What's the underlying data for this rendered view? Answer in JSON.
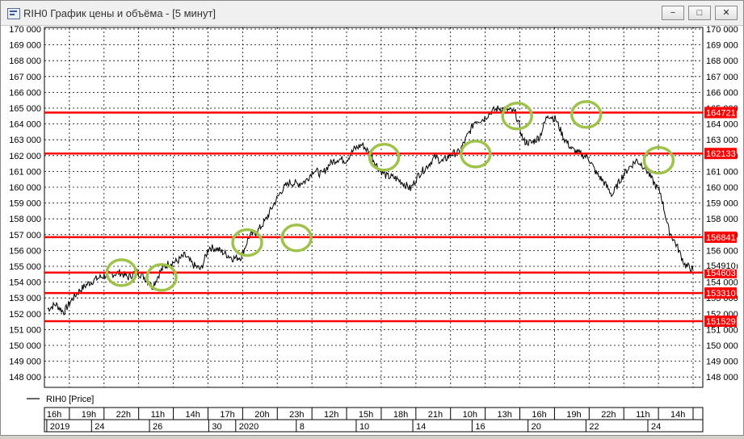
{
  "window": {
    "title": "RIH0 График цены и объёма - [5 минут]",
    "icon": "chart-window-icon",
    "buttons": [
      "minimize-icon",
      "restore-icon",
      "close-icon"
    ]
  },
  "chart_data": {
    "type": "line",
    "ylim": [
      148000,
      170000
    ],
    "y_ticks": [
      "170 000",
      "169 000",
      "168 000",
      "167 000",
      "166 000",
      "165 000",
      "164 000",
      "163 000",
      "162 000",
      "161 000",
      "160 000",
      "159 000",
      "158 000",
      "157 000",
      "156 000",
      "155 000",
      "154 000",
      "153 000",
      "152 000",
      "151 000",
      "150 000",
      "149 000",
      "148 000"
    ],
    "grid": true,
    "legend": {
      "label": "RIH0 [Price]",
      "placement": "bottom-left"
    },
    "x_ticks_top": [
      "16h",
      "19h",
      "22h",
      "11h",
      "14h",
      "17h",
      "20h",
      "23h",
      "12h",
      "15h",
      "18h",
      "21h",
      "10h",
      "13h",
      "16h",
      "19h",
      "22h",
      "11h",
      "14h"
    ],
    "x_ticks_bottom": [
      "2019",
      "24",
      "26",
      "30",
      "2020",
      "8",
      "10",
      "14",
      "16",
      "20",
      "22",
      "24"
    ],
    "series": [
      {
        "name": "RIH0 [Price]",
        "color": "#000000",
        "values": [
          152300,
          152600,
          152100,
          152900,
          153500,
          153900,
          154200,
          154400,
          154500,
          154600,
          154300,
          154700,
          154300,
          153700,
          154700,
          155200,
          155300,
          155700,
          155100,
          154800,
          156200,
          156100,
          155800,
          155500,
          155600,
          156900,
          157200,
          157900,
          158900,
          159800,
          160300,
          160200,
          160400,
          161100,
          160800,
          161500,
          161800,
          161700,
          162400,
          162700,
          162100,
          161200,
          160700,
          160600,
          160300,
          159900,
          160800,
          161300,
          161900,
          161600,
          162100,
          162200,
          163200,
          164200,
          164300,
          164800,
          165000,
          164900,
          164700,
          162900,
          162800,
          163200,
          164600,
          164300,
          163100,
          162400,
          162100,
          161900,
          160900,
          160300,
          159500,
          160500,
          161200,
          161700,
          161300,
          160400,
          159600,
          157300,
          156300,
          155100,
          154800
        ]
      }
    ],
    "levels": [
      {
        "value": 164721,
        "label": "164721"
      },
      {
        "value": 162133,
        "label": "162133"
      },
      {
        "value": 156841,
        "label": "156841"
      },
      {
        "value": 154603,
        "label": "154603"
      },
      {
        "value": 153310,
        "label": "153310"
      },
      {
        "value": 151529,
        "label": "151529"
      }
    ],
    "last_price_label": "154910",
    "level_color": "#ff0000",
    "highlight_color": "#9fc34a",
    "highlights": [
      {
        "x": 0.117,
        "y": 154600
      },
      {
        "x": 0.178,
        "y": 154300
      },
      {
        "x": 0.308,
        "y": 156500
      },
      {
        "x": 0.383,
        "y": 156800
      },
      {
        "x": 0.516,
        "y": 161900
      },
      {
        "x": 0.655,
        "y": 162100
      },
      {
        "x": 0.718,
        "y": 164500
      },
      {
        "x": 0.823,
        "y": 164600
      },
      {
        "x": 0.933,
        "y": 161700
      }
    ]
  }
}
